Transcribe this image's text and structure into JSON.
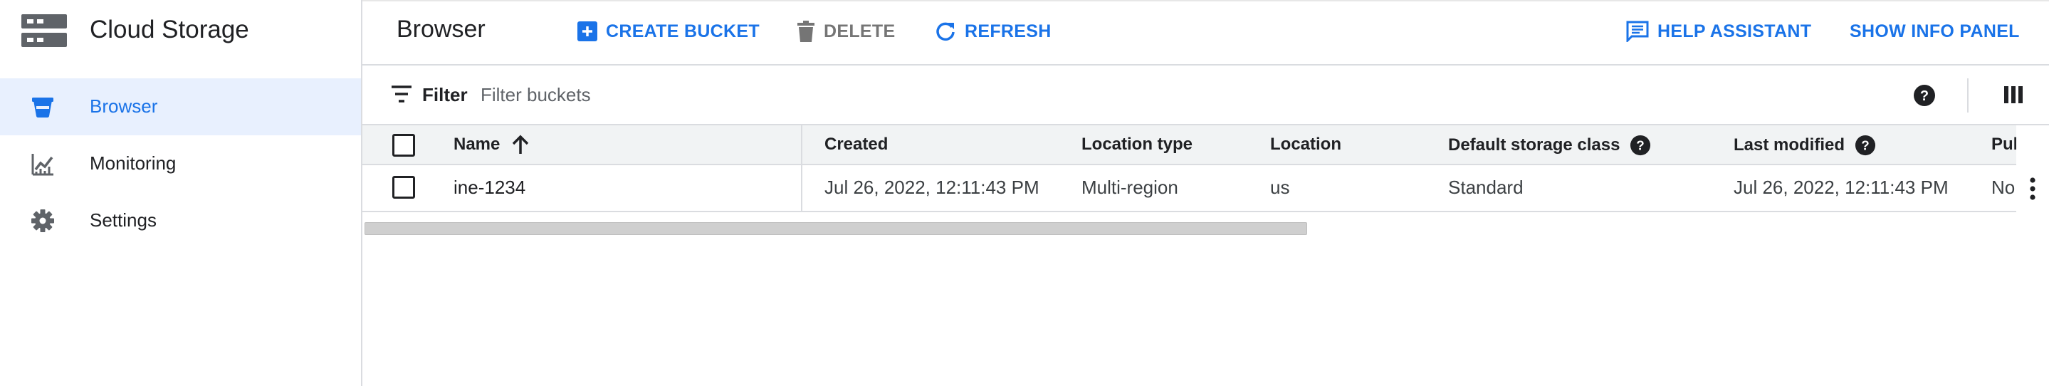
{
  "app": {
    "title": "Cloud Storage",
    "logo_icon": "storage-server-icon"
  },
  "sidebar": {
    "items": [
      {
        "label": "Browser",
        "icon": "bucket-icon",
        "active": true
      },
      {
        "label": "Monitoring",
        "icon": "chart-line-icon",
        "active": false
      },
      {
        "label": "Settings",
        "icon": "gear-icon",
        "active": false
      }
    ]
  },
  "header": {
    "title": "Browser",
    "create_bucket": "CREATE BUCKET",
    "delete": "DELETE",
    "refresh": "REFRESH",
    "help_assistant": "HELP ASSISTANT",
    "show_info_panel": "SHOW INFO PANEL"
  },
  "filter": {
    "label": "Filter",
    "placeholder": "Filter buckets",
    "value": ""
  },
  "table": {
    "columns": [
      "Name",
      "Created",
      "Location type",
      "Location",
      "Default storage class",
      "Last modified",
      "Pul"
    ],
    "sort": {
      "column": "Name",
      "direction": "ascending"
    },
    "rows": [
      {
        "name": "ine-1234",
        "created": "Jul 26, 2022, 12:11:43 PM",
        "location_type": "Multi-region",
        "location": "us",
        "storage_class": "Standard",
        "last_modified": "Jul 26, 2022, 12:11:43 PM",
        "public": "No"
      }
    ]
  },
  "colors": {
    "accent": "#1a73e8",
    "active_bg": "#e8f0fe",
    "header_bg": "#f1f3f4",
    "divider": "#dadce0",
    "disabled": "#757575"
  }
}
